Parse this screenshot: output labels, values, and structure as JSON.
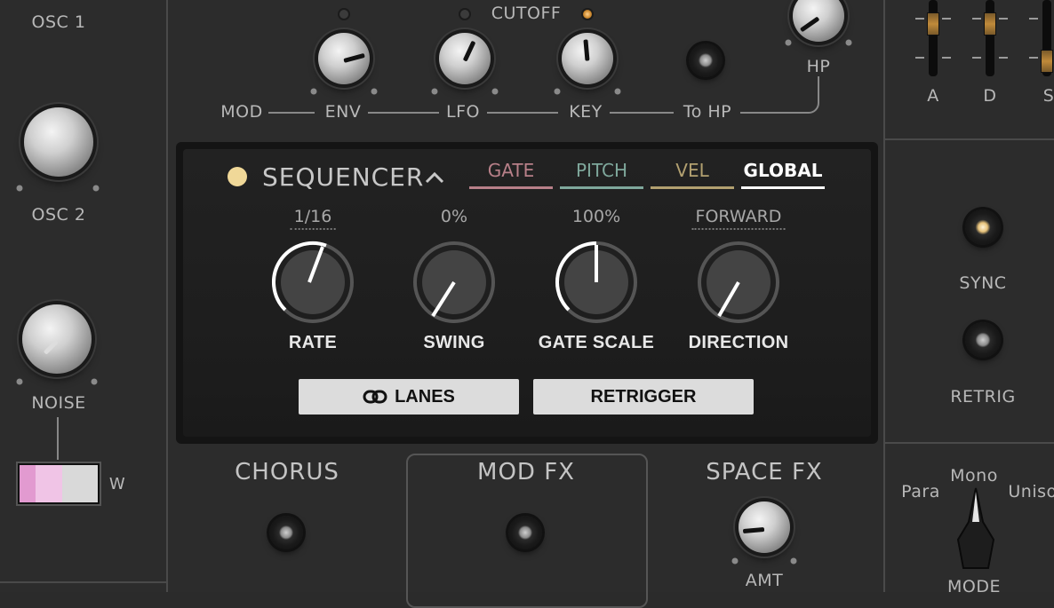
{
  "left_column": {
    "osc1_label": "OSC 1",
    "osc2_label": "OSC 2",
    "noise_label": "NOISE",
    "wave_toggle_label": "W",
    "wave_toggle_colors": [
      "#e29ad0",
      "#f0c4e6",
      "#d9d9d9"
    ]
  },
  "filter": {
    "cutoff_label": "CUTOFF",
    "mod_label": "MOD",
    "env_label": "ENV",
    "lfo_label": "LFO",
    "key_label": "KEY",
    "to_hp_label": "To HP",
    "hp_label": "HP"
  },
  "envelope": {
    "a_label": "A",
    "d_label": "D",
    "s_label": "S"
  },
  "sequencer": {
    "title": "SEQUENCER",
    "tabs": [
      {
        "label": "GATE",
        "color": "#b88089",
        "active": false
      },
      {
        "label": "PITCH",
        "color": "#7fa89c",
        "active": false
      },
      {
        "label": "VEL",
        "color": "#b2a070",
        "active": false
      },
      {
        "label": "GLOBAL",
        "color": "#ffffff",
        "active": true
      }
    ],
    "knobs": [
      {
        "name": "RATE",
        "value": "1/16"
      },
      {
        "name": "SWING",
        "value": "0%"
      },
      {
        "name": "GATE SCALE",
        "value": "100%"
      },
      {
        "name": "DIRECTION",
        "value": "FORWARD"
      }
    ],
    "lanes_label": "LANES",
    "retrigger_label": "RETRIGGER"
  },
  "right_column": {
    "sync_label": "SYNC",
    "retrig_label": "RETRIG",
    "para_label": "Para",
    "mono_label": "Mono",
    "unison_label": "Uniso",
    "mode_label": "MODE"
  },
  "effects": {
    "chorus_label": "CHORUS",
    "mod_fx_label": "MOD FX",
    "space_fx_label": "SPACE FX",
    "amt_label": "AMT"
  },
  "colors": {
    "panel": "#2c2c2c",
    "sequencer_dot": "#f0d898",
    "led_on": "#c8842a"
  }
}
